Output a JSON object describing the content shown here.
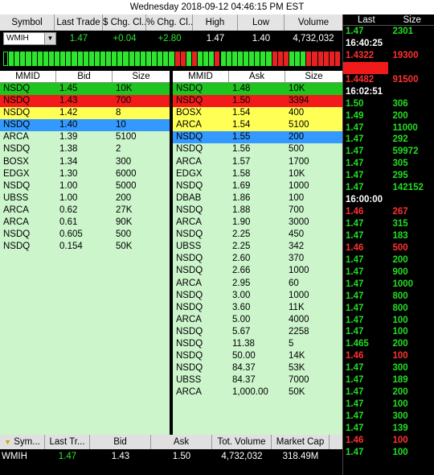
{
  "title": "Wednesday 2018-09-12 04:46:15 PM EST",
  "quote": {
    "headers": [
      "Symbol",
      "Last Trade",
      "$ Chg. Cl...",
      "% Chg. Cl...",
      "High",
      "Low",
      "Volume"
    ],
    "symbol": "WMIH",
    "last_trade": "1.47",
    "chg": "+0.04",
    "pct_chg": "+2.80",
    "high": "1.47",
    "low": "1.40",
    "volume": "4,732,032"
  },
  "ticker_colors": [
    "#000",
    "#2ee52e",
    "#2ee52e",
    "#2ee52e",
    "#2ee52e",
    "#2ee52e",
    "#2ee52e",
    "#2ee52e",
    "#2ee52e",
    "#2ee52e",
    "#2ee52e",
    "#2ee52e",
    "#2ee52e",
    "#2ee52e",
    "#2ee52e",
    "#2ee52e",
    "#2ee52e",
    "#2ee52e",
    "#2ee52e",
    "#2ee52e",
    "#2ee52e",
    "#2ee52e",
    "#2ee52e",
    "#2ee52e",
    "#2ee52e",
    "#2ee52e",
    "#2ee52e",
    "#2ee52e",
    "#2ee52e",
    "#2ee52e",
    "#e82222",
    "#e82222",
    "#2ee52e",
    "#e82222",
    "#2ee52e",
    "#2ee52e",
    "#2ee52e",
    "#e82222",
    "#2ee52e",
    "#2ee52e",
    "#2ee52e",
    "#2ee52e",
    "#2ee52e",
    "#2ee52e",
    "#2ee52e",
    "#2ee52e",
    "#2ee52e",
    "#e82222",
    "#e82222",
    "#e82222",
    "#2ee52e",
    "#2ee52e",
    "#2ee52e",
    "#e82222",
    "#e82222",
    "#e82222",
    "#e82222",
    "#e82222",
    "#e82222"
  ],
  "bid": {
    "headers": [
      "MMID",
      "Bid",
      "Size"
    ],
    "rows": [
      {
        "mmid": "NSDQ",
        "price": "1.45",
        "size": "10K",
        "color": "green"
      },
      {
        "mmid": "NSDQ",
        "price": "1.43",
        "size": "700",
        "color": "red"
      },
      {
        "mmid": "NSDQ",
        "price": "1.42",
        "size": "8",
        "color": "yellow"
      },
      {
        "mmid": "NSDQ",
        "price": "1.40",
        "size": "10",
        "color": "blue"
      },
      {
        "mmid": "ARCA",
        "price": "1.39",
        "size": "5100",
        "color": ""
      },
      {
        "mmid": "NSDQ",
        "price": "1.38",
        "size": "2",
        "color": ""
      },
      {
        "mmid": "BOSX",
        "price": "1.34",
        "size": "300",
        "color": ""
      },
      {
        "mmid": "EDGX",
        "price": "1.30",
        "size": "6000",
        "color": ""
      },
      {
        "mmid": "NSDQ",
        "price": "1.00",
        "size": "5000",
        "color": ""
      },
      {
        "mmid": "UBSS",
        "price": "1.00",
        "size": "200",
        "color": ""
      },
      {
        "mmid": "ARCA",
        "price": "0.62",
        "size": "27K",
        "color": ""
      },
      {
        "mmid": "ARCA",
        "price": "0.61",
        "size": "90K",
        "color": ""
      },
      {
        "mmid": "NSDQ",
        "price": "0.605",
        "size": "500",
        "color": ""
      },
      {
        "mmid": "NSDQ",
        "price": "0.154",
        "size": "50K",
        "color": ""
      }
    ]
  },
  "ask": {
    "headers": [
      "MMID",
      "Ask",
      "Size"
    ],
    "rows": [
      {
        "mmid": "NSDQ",
        "price": "1.48",
        "size": "10K",
        "color": "green"
      },
      {
        "mmid": "NSDQ",
        "price": "1.50",
        "size": "3394",
        "color": "red"
      },
      {
        "mmid": "BOSX",
        "price": "1.54",
        "size": "400",
        "color": "yellow"
      },
      {
        "mmid": "ARCA",
        "price": "1.54",
        "size": "5100",
        "color": "yellow"
      },
      {
        "mmid": "NSDQ",
        "price": "1.55",
        "size": "200",
        "color": "blue"
      },
      {
        "mmid": "NSDQ",
        "price": "1.56",
        "size": "500",
        "color": ""
      },
      {
        "mmid": "ARCA",
        "price": "1.57",
        "size": "1700",
        "color": ""
      },
      {
        "mmid": "EDGX",
        "price": "1.58",
        "size": "10K",
        "color": ""
      },
      {
        "mmid": "NSDQ",
        "price": "1.69",
        "size": "1000",
        "color": ""
      },
      {
        "mmid": "DBAB",
        "price": "1.86",
        "size": "100",
        "color": ""
      },
      {
        "mmid": "NSDQ",
        "price": "1.88",
        "size": "700",
        "color": ""
      },
      {
        "mmid": "ARCA",
        "price": "1.90",
        "size": "3000",
        "color": ""
      },
      {
        "mmid": "NSDQ",
        "price": "2.25",
        "size": "450",
        "color": ""
      },
      {
        "mmid": "UBSS",
        "price": "2.25",
        "size": "342",
        "color": ""
      },
      {
        "mmid": "NSDQ",
        "price": "2.60",
        "size": "370",
        "color": ""
      },
      {
        "mmid": "NSDQ",
        "price": "2.66",
        "size": "1000",
        "color": ""
      },
      {
        "mmid": "ARCA",
        "price": "2.95",
        "size": "60",
        "color": ""
      },
      {
        "mmid": "NSDQ",
        "price": "3.00",
        "size": "1000",
        "color": ""
      },
      {
        "mmid": "NSDQ",
        "price": "3.60",
        "size": "11K",
        "color": ""
      },
      {
        "mmid": "ARCA",
        "price": "5.00",
        "size": "4000",
        "color": ""
      },
      {
        "mmid": "NSDQ",
        "price": "5.67",
        "size": "2258",
        "color": ""
      },
      {
        "mmid": "NSDQ",
        "price": "11.38",
        "size": "5",
        "color": ""
      },
      {
        "mmid": "NSDQ",
        "price": "50.00",
        "size": "14K",
        "color": ""
      },
      {
        "mmid": "NSDQ",
        "price": "84.37",
        "size": "53K",
        "color": ""
      },
      {
        "mmid": "UBSS",
        "price": "84.37",
        "size": "7000",
        "color": ""
      },
      {
        "mmid": "ARCA",
        "price": "1,000.00",
        "size": "50K",
        "color": ""
      }
    ]
  },
  "watchlist": {
    "headers": [
      "Sym...",
      "Last Tr...",
      "Bid",
      "Ask",
      "Tot. Volume",
      "Market Cap"
    ],
    "row": {
      "symbol": "WMIH",
      "last": "1.47",
      "bid": "1.43",
      "ask": "1.50",
      "volume": "4,732,032",
      "market_cap": "318.49M"
    }
  },
  "time_sales": {
    "headers": [
      "Last",
      "Size"
    ],
    "rows": [
      {
        "p": "1.47",
        "s": "2301",
        "c": "green"
      },
      {
        "p": "16:40:25",
        "s": "",
        "c": "time"
      },
      {
        "p": "1.4322",
        "s": "19300",
        "c": "red"
      },
      {
        "p": "",
        "s": "",
        "c": "time hl"
      },
      {
        "p": "1.4482",
        "s": "91500",
        "c": "red"
      },
      {
        "p": "16:02:51",
        "s": "",
        "c": "time"
      },
      {
        "p": "1.50",
        "s": "306",
        "c": "green"
      },
      {
        "p": "1.49",
        "s": "200",
        "c": "green"
      },
      {
        "p": "1.47",
        "s": "11000",
        "c": "green"
      },
      {
        "p": "1.47",
        "s": "292",
        "c": "green"
      },
      {
        "p": "1.47",
        "s": "59972",
        "c": "green"
      },
      {
        "p": "1.47",
        "s": "305",
        "c": "green"
      },
      {
        "p": "1.47",
        "s": "295",
        "c": "green"
      },
      {
        "p": "1.47",
        "s": "142152",
        "c": "green"
      },
      {
        "p": "16:00:00",
        "s": "",
        "c": "time"
      },
      {
        "p": "1.46",
        "s": "267",
        "c": "red"
      },
      {
        "p": "1.47",
        "s": "315",
        "c": "green"
      },
      {
        "p": "1.47",
        "s": "183",
        "c": "green"
      },
      {
        "p": "1.46",
        "s": "500",
        "c": "red"
      },
      {
        "p": "1.47",
        "s": "200",
        "c": "green"
      },
      {
        "p": "1.47",
        "s": "900",
        "c": "green"
      },
      {
        "p": "1.47",
        "s": "1000",
        "c": "green"
      },
      {
        "p": "1.47",
        "s": "800",
        "c": "green"
      },
      {
        "p": "1.47",
        "s": "800",
        "c": "green"
      },
      {
        "p": "1.47",
        "s": "100",
        "c": "green"
      },
      {
        "p": "1.47",
        "s": "100",
        "c": "green"
      },
      {
        "p": "1.465",
        "s": "200",
        "c": "green"
      },
      {
        "p": "1.46",
        "s": "100",
        "c": "red"
      },
      {
        "p": "1.47",
        "s": "300",
        "c": "green"
      },
      {
        "p": "1.47",
        "s": "189",
        "c": "green"
      },
      {
        "p": "1.47",
        "s": "200",
        "c": "green"
      },
      {
        "p": "1.47",
        "s": "100",
        "c": "green"
      },
      {
        "p": "1.47",
        "s": "300",
        "c": "green"
      },
      {
        "p": "1.47",
        "s": "139",
        "c": "green"
      },
      {
        "p": "1.46",
        "s": "100",
        "c": "red"
      },
      {
        "p": "1.47",
        "s": "100",
        "c": "green"
      }
    ]
  }
}
